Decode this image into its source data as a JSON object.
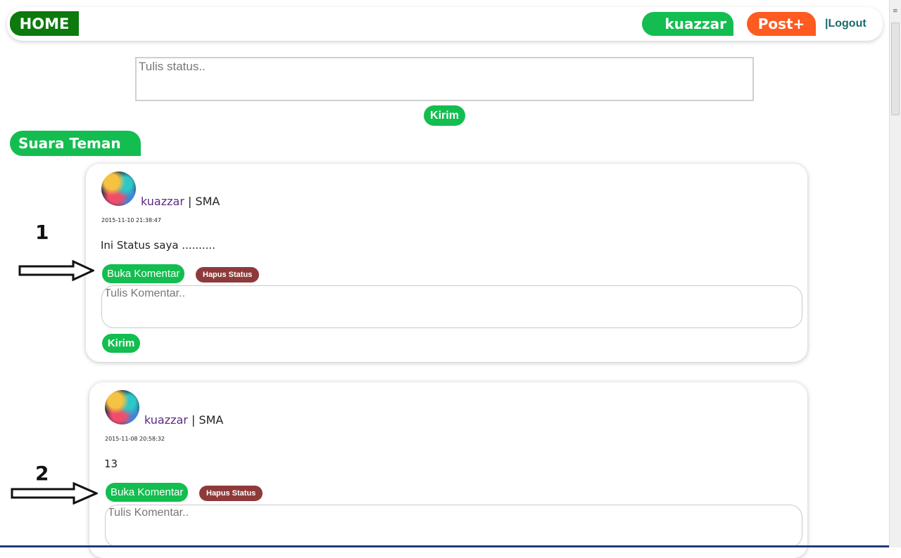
{
  "header": {
    "home_label": "HOME",
    "username": "kuazzar",
    "post_label": "Post+",
    "logout_label": "|Logout"
  },
  "composer": {
    "placeholder": "Tulis status..",
    "send_label": "Kirim"
  },
  "section_title": "Suara Teman",
  "posts": [
    {
      "author": "kuazzar",
      "separator": " | ",
      "group": "SMA",
      "timestamp": "2015-11-10 21:38:47",
      "content": "Ini Status saya ..........",
      "open_comments_label": "Buka Komentar",
      "delete_label": "Hapus Status",
      "comment_placeholder": "Tulis Komentar..",
      "comment_send_label": "Kirim"
    },
    {
      "author": "kuazzar",
      "separator": " | ",
      "group": "SMA",
      "timestamp": "2015-11-08 20:58:32",
      "content": "13",
      "open_comments_label": "Buka Komentar",
      "delete_label": "Hapus Status",
      "comment_placeholder": "Tulis Komentar.."
    }
  ],
  "annotations": [
    "1",
    "2"
  ],
  "colors": {
    "accent_green": "#14bd50",
    "home_green": "#0c7a0c",
    "post_orange": "#ff5a1f",
    "delete_red": "#8f3a3a",
    "author_purple": "#5b2a86"
  }
}
